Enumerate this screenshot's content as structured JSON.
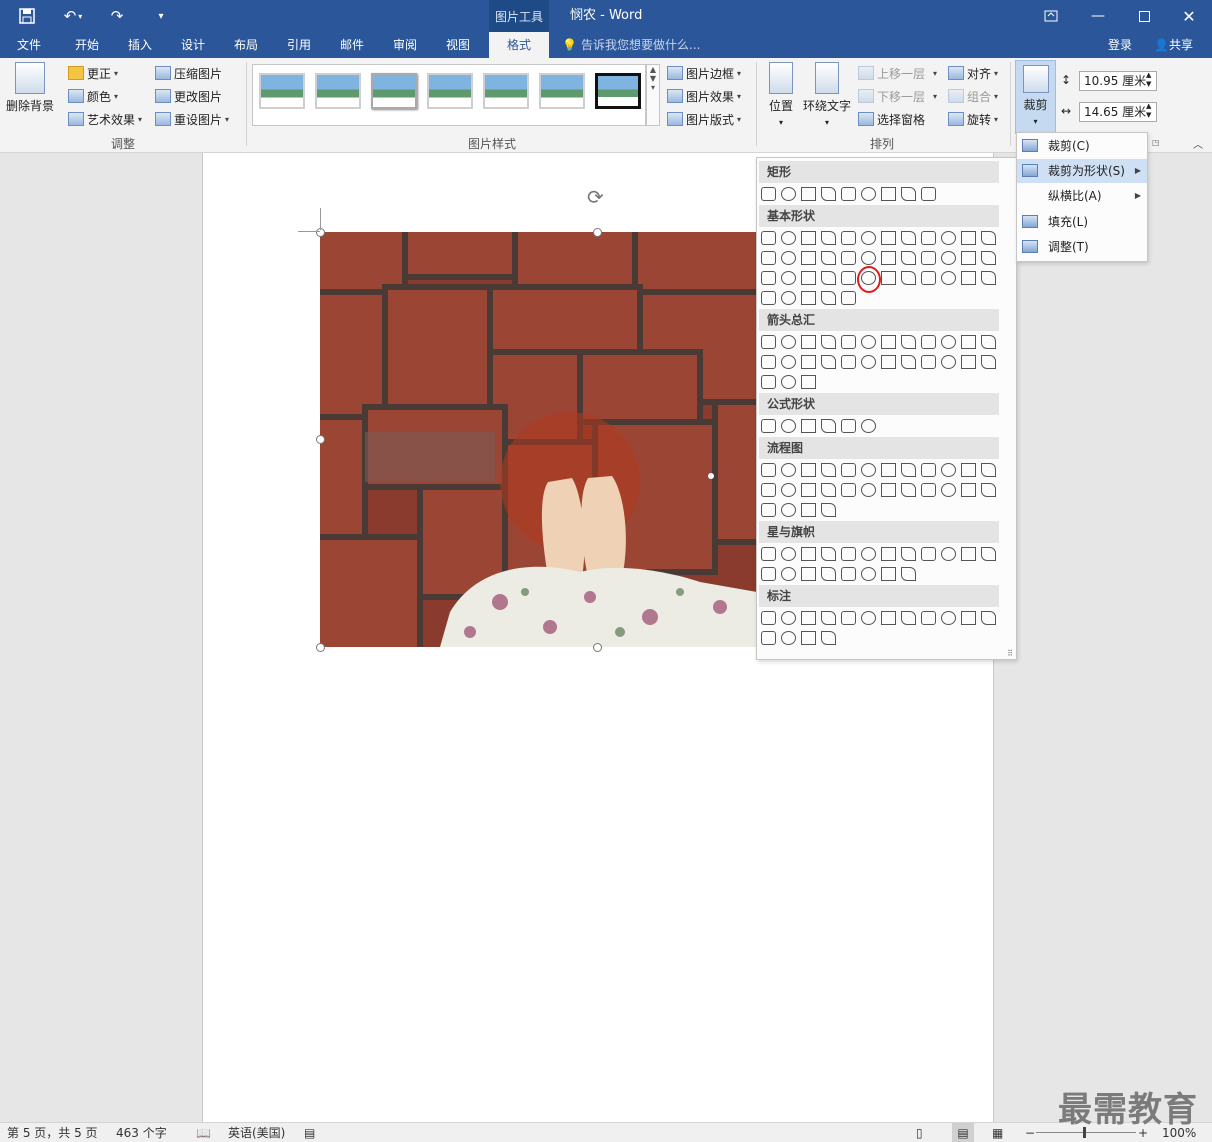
{
  "titlebar": {
    "contextual_tab_group": "图片工具",
    "doc_title": "悯农 - Word"
  },
  "tabs": {
    "file": "文件",
    "home": "开始",
    "insert": "插入",
    "design": "设计",
    "layout": "布局",
    "references": "引用",
    "mailings": "邮件",
    "review": "审阅",
    "view": "视图",
    "format": "格式",
    "tell_me": "告诉我您想要做什么...",
    "sign_in": "登录",
    "share": "共享"
  },
  "ribbon": {
    "remove_background": "删除背景",
    "corrections": "更正",
    "color": "颜色",
    "artistic_effects": "艺术效果",
    "compress_pictures": "压缩图片",
    "change_picture": "更改图片",
    "reset_picture": "重设图片",
    "group_adjust": "调整",
    "picture_border": "图片边框",
    "picture_effects": "图片效果",
    "picture_layout": "图片版式",
    "group_picture_styles": "图片样式",
    "position": "位置",
    "wrap_text": "环绕文字",
    "bring_forward": "上移一层",
    "send_backward": "下移一层",
    "selection_pane": "选择窗格",
    "align": "对齐",
    "group": "组合",
    "rotate": "旋转",
    "group_arrange": "排列",
    "crop": "裁剪",
    "height": "10.95 厘米",
    "width": "14.65 厘米"
  },
  "crop_menu": {
    "crop": "裁剪(C)",
    "crop_to_shape": "裁剪为形状(S)",
    "aspect_ratio": "纵横比(A)",
    "fill": "填充(L)",
    "fit": "调整(T)"
  },
  "shapes_panel": {
    "categories": [
      "矩形",
      "基本形状",
      "箭头总汇",
      "公式形状",
      "流程图",
      "星与旗帜",
      "标注"
    ]
  },
  "statusbar": {
    "page": "第 5 页，共 5 页",
    "words": "463 个字",
    "language": "英语(美国)",
    "zoom": "100%"
  },
  "watermark": "最需教育"
}
